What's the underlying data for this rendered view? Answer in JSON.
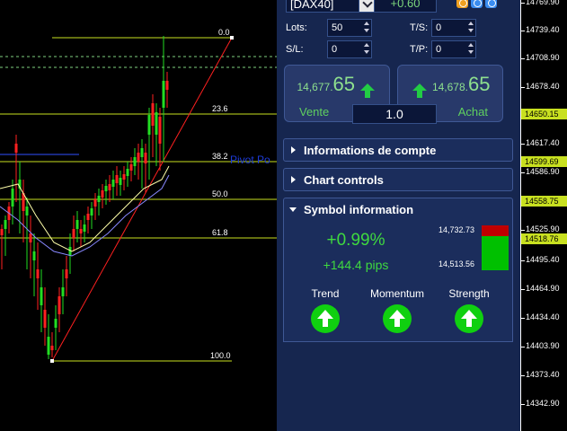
{
  "header": {
    "symbol": "[DAX40]",
    "spread": "+0.60"
  },
  "form": {
    "lots_label": "Lots:",
    "lots_value": "50",
    "ts_label": "T/S:",
    "ts_value": "0",
    "sl_label": "S/L:",
    "sl_value": "0",
    "tp_label": "T/P:",
    "tp_value": "0"
  },
  "sell": {
    "price_small": "14,677.",
    "price_big": "65",
    "label": "Vente"
  },
  "buy": {
    "price_small": "14,678.",
    "price_big": "65",
    "label": "Achat"
  },
  "lot_size": "1.0",
  "sections": {
    "account": "Informations de compte",
    "chart_controls": "Chart controls",
    "symbol_info": "Symbol information"
  },
  "symbol_info": {
    "change_pct": "+0.99%",
    "change_pips": "+144.4 pips",
    "high": "14,732.73",
    "low": "14,513.56",
    "indicators": [
      "Trend",
      "Momentum",
      "Strength"
    ]
  },
  "chart": {
    "fib_labels": [
      "0.0",
      "23.6",
      "38.2",
      "50.0",
      "61.8",
      "100.0"
    ],
    "watermark": "Pivot Po"
  },
  "axis": {
    "ticks": [
      "14769.90",
      "14739.40",
      "14708.90",
      "14678.40",
      "14617.40",
      "14586.90",
      "14525.90",
      "14495.40",
      "14464.90",
      "14434.40",
      "14403.90",
      "14373.40",
      "14342.90"
    ],
    "tags": [
      "14650.15",
      "14599.69",
      "14558.75",
      "14518.76"
    ]
  },
  "colors": {
    "panel_bg": "#16264f",
    "green": "#3fd93f",
    "fib_line": "#c8e020",
    "trend_line": "#ff2020"
  }
}
